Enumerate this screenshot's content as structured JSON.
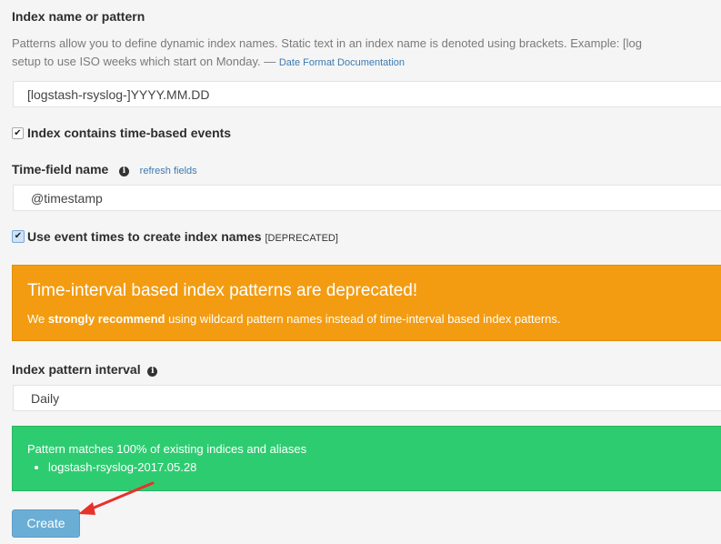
{
  "index_pattern": {
    "label": "Index name or pattern",
    "help_line1": "Patterns allow you to define dynamic index names. Static text in an index name is denoted using brackets. Example: [log",
    "help_line2": "setup to use ISO weeks which start on Monday. —",
    "help_link": "Date Format Documentation",
    "value": "[logstash-rsyslog-]YYYY.MM.DD"
  },
  "time_based": {
    "label": "Index contains time-based events",
    "checked": true
  },
  "time_field": {
    "label": "Time-field name",
    "refresh_link": "refresh fields",
    "value": "@timestamp"
  },
  "event_times": {
    "label": "Use event times to create index names",
    "tag": "[DEPRECATED]",
    "checked": true
  },
  "warning": {
    "title": "Time-interval based index patterns are deprecated!",
    "text_pre": "We",
    "text_strong": "strongly recommend",
    "text_post": "using wildcard pattern names instead of time-interval based index patterns."
  },
  "interval": {
    "label": "Index pattern interval",
    "value": "Daily"
  },
  "match": {
    "title": "Pattern matches 100% of existing indices and aliases",
    "items": [
      "logstash-rsyslog-2017.05.28"
    ]
  },
  "create_label": "Create",
  "colors": {
    "warning": "#f39c12",
    "success": "#2ecc71",
    "button": "#6aaed6",
    "link": "#3a7bb3",
    "arrow": "#e8312b"
  }
}
